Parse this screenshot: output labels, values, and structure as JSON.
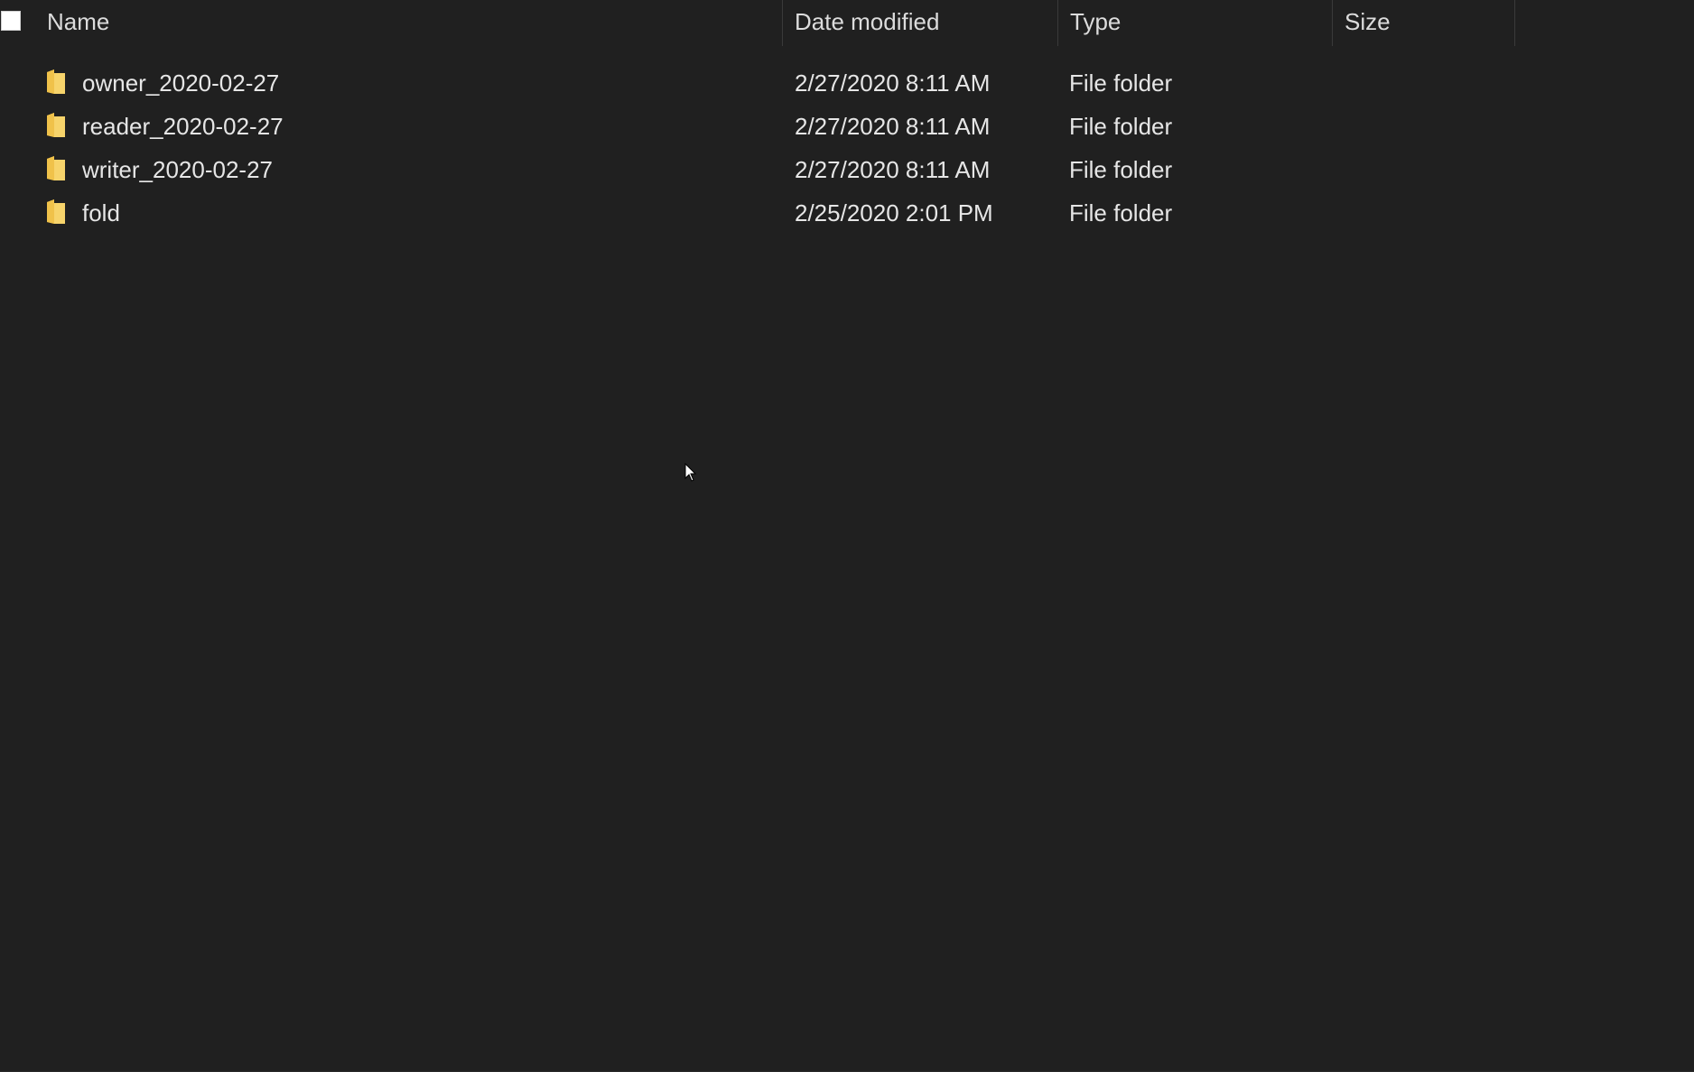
{
  "columns": {
    "name": "Name",
    "date_modified": "Date modified",
    "type": "Type",
    "size": "Size"
  },
  "rows": [
    {
      "icon": "folder-icon",
      "name": "owner_2020-02-27",
      "date_modified": "2/27/2020 8:11 AM",
      "type": "File folder",
      "size": ""
    },
    {
      "icon": "folder-icon",
      "name": "reader_2020-02-27",
      "date_modified": "2/27/2020 8:11 AM",
      "type": "File folder",
      "size": ""
    },
    {
      "icon": "folder-icon",
      "name": "writer_2020-02-27",
      "date_modified": "2/27/2020 8:11 AM",
      "type": "File folder",
      "size": ""
    },
    {
      "icon": "folder-icon",
      "name": "fold",
      "date_modified": "2/25/2020 2:01 PM",
      "type": "File folder",
      "size": ""
    }
  ],
  "colors": {
    "background": "#202020",
    "text": "#e6e6e6",
    "folder": "#f7c948"
  }
}
